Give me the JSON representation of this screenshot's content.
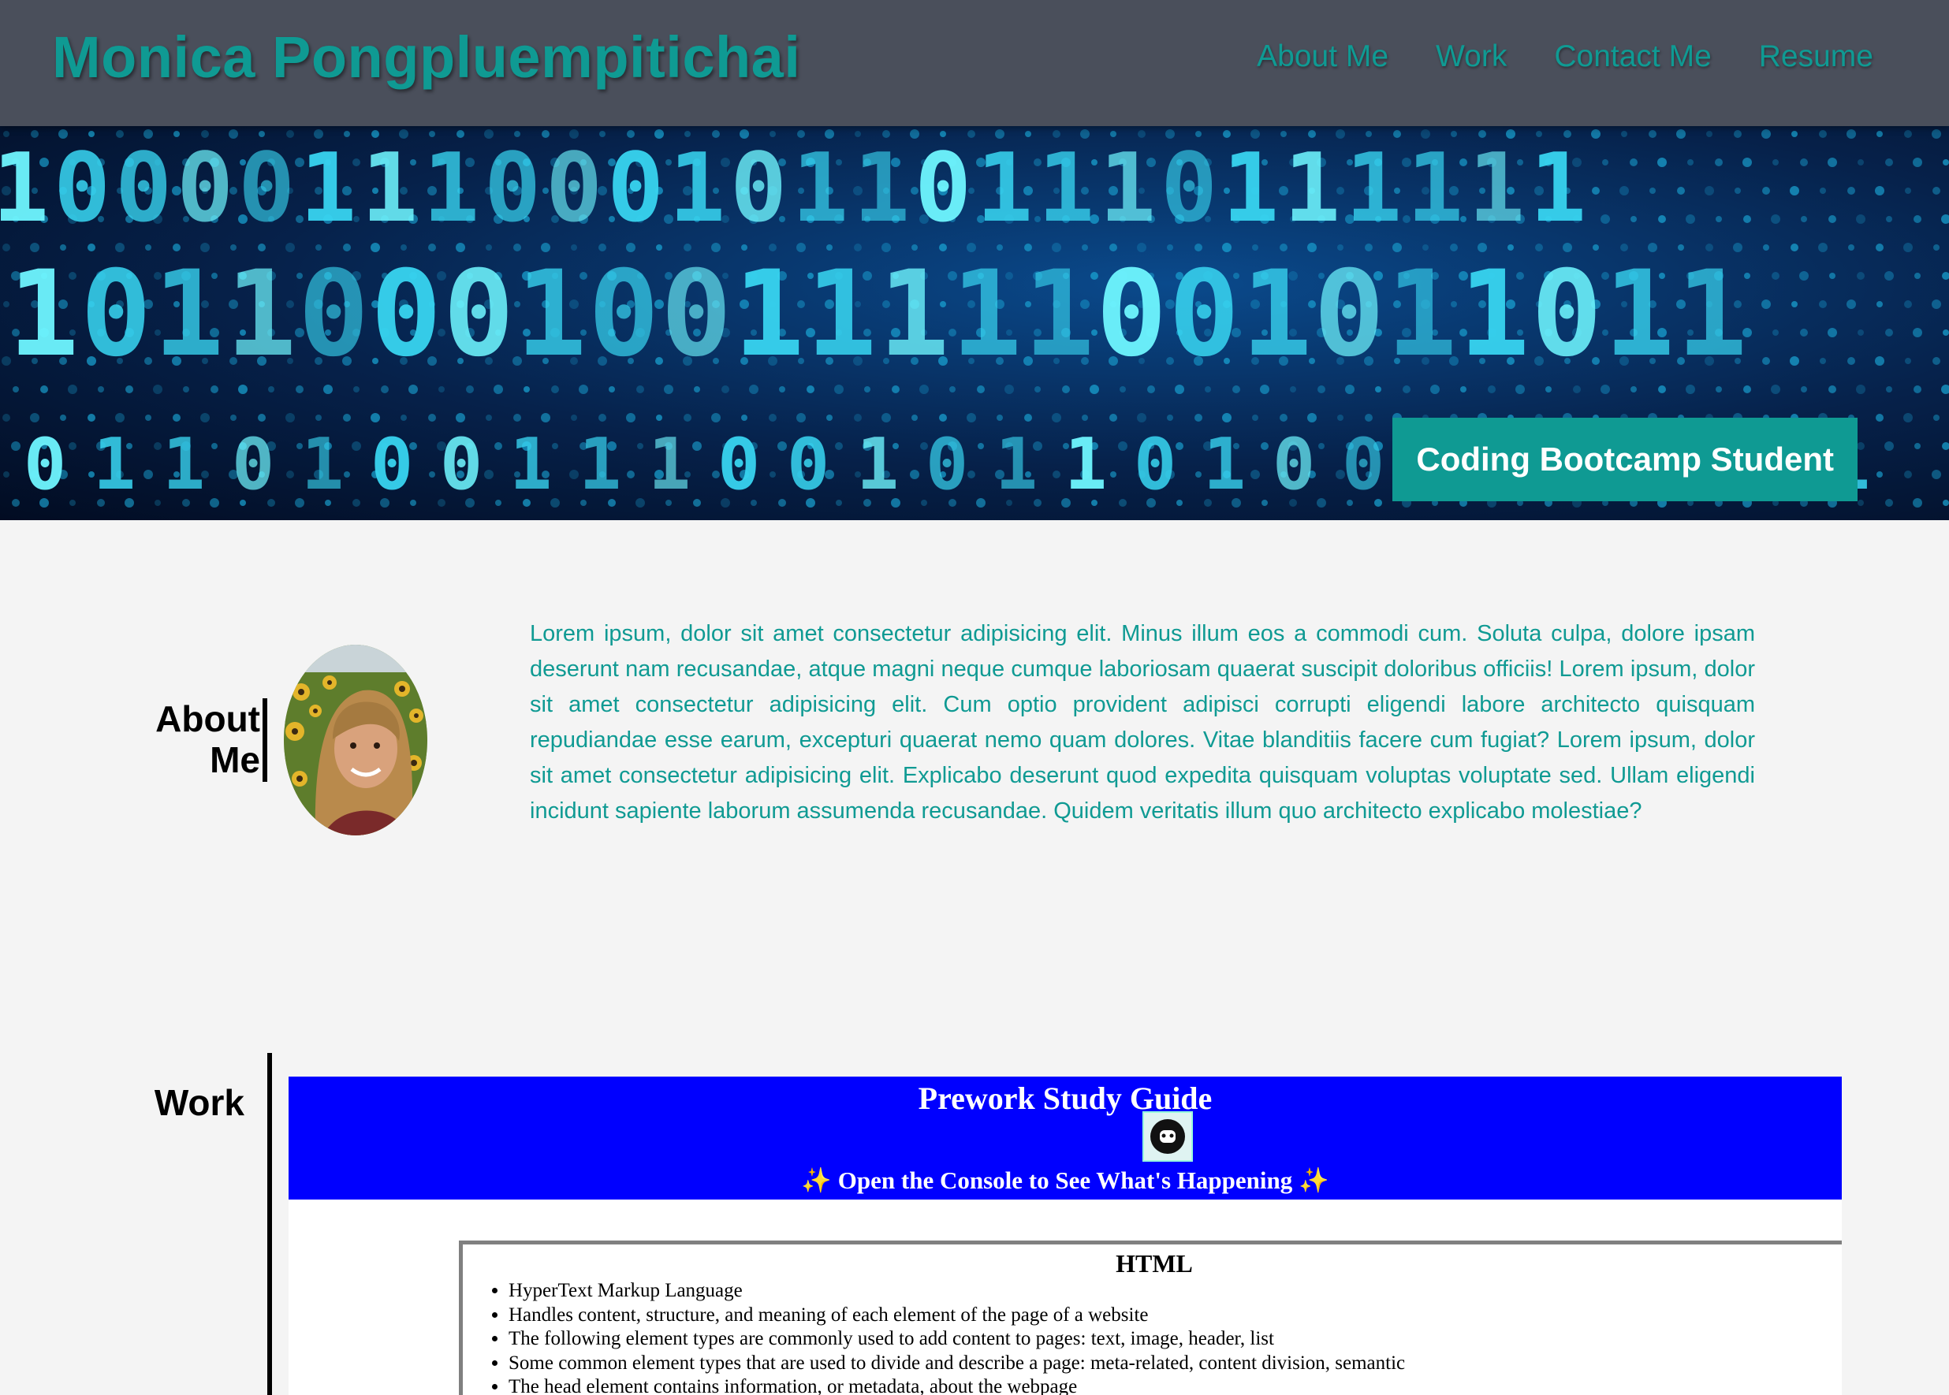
{
  "header": {
    "site_title": "Monica Pongpluempitichai",
    "nav": [
      "About Me",
      "Work",
      "Contact Me",
      "Resume"
    ],
    "accent_color": "#0f9a93",
    "background_color": "#4a4f5b"
  },
  "hero": {
    "badge_text": "Coding Bootcamp Student"
  },
  "about": {
    "heading_line1": "About",
    "heading_line2": "Me",
    "body": "Lorem ipsum, dolor sit amet consectetur adipisicing elit. Minus illum eos a commodi cum. Soluta culpa, dolore ipsam deserunt nam recusandae, atque magni neque cumque laboriosam quaerat suscipit doloribus officiis! Lorem ipsum, dolor sit amet consectetur adipisicing elit. Cum optio provident adipisci corrupti eligendi labore architecto quisquam repudiandae esse earum, excepturi quaerat nemo quam dolores. Vitae blanditiis facere cum fugiat? Lorem ipsum, dolor sit amet consectetur adipisicing elit. Explicabo deserunt quod expedita quisquam voluptas voluptate sed. Ullam eligendi incidunt sapiente laborum assumenda recusandae. Quidem veritatis illum quo architecto explicabo molestiae?"
  },
  "work": {
    "heading": "Work",
    "project": {
      "title": "Prework Study Guide",
      "subtitle": "✨ Open the Console to See What's Happening ✨",
      "banner_color": "#0000ff",
      "section_title": "HTML",
      "items": [
        "HyperText Markup Language",
        "Handles content, structure, and meaning of each element of the page of a website",
        "The following element types are commonly used to add content to pages: text, image, header, list",
        "Some common element types that are used to divide and describe a page: meta-related, content division, semantic",
        "The head element contains information, or metadata, about the webpage"
      ]
    }
  }
}
